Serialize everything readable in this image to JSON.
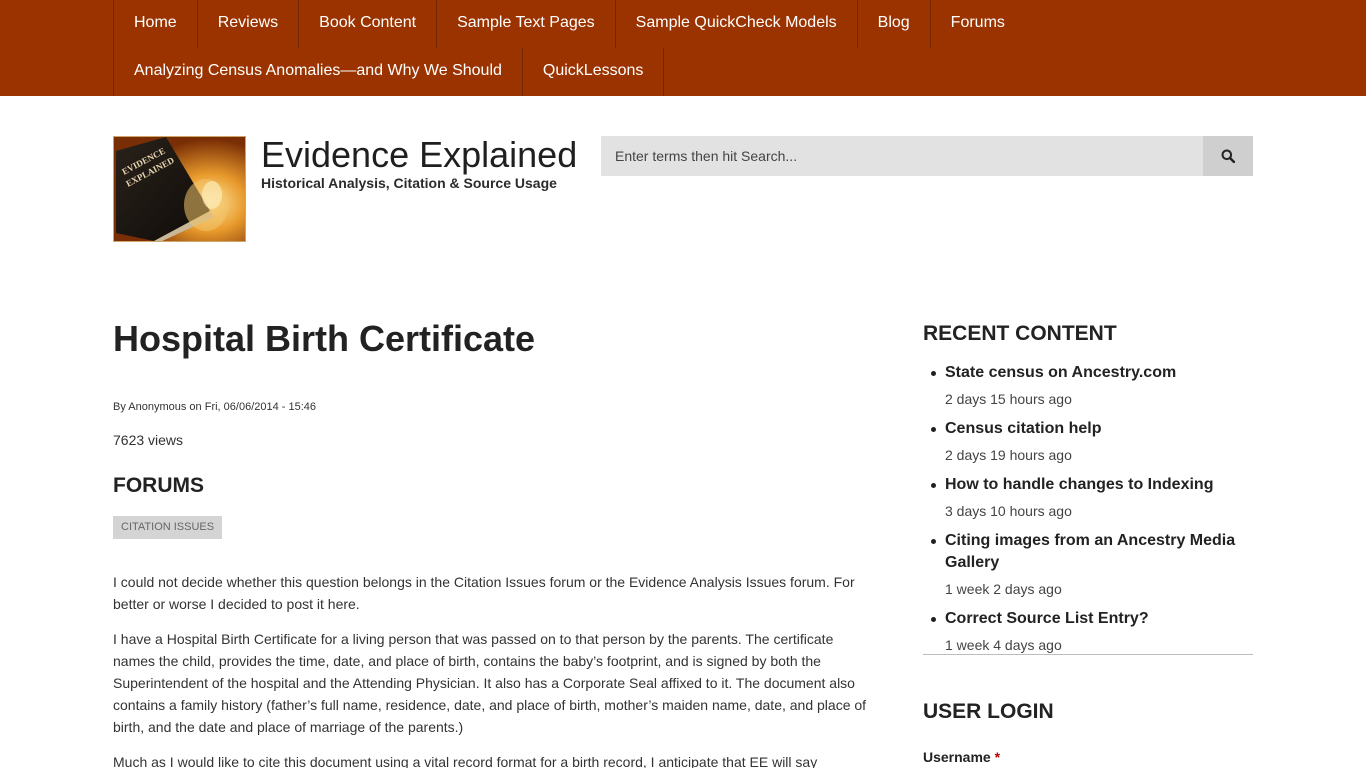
{
  "nav": {
    "row1": [
      "Home",
      "Reviews",
      "Book Content",
      "Sample Text Pages",
      "Sample QuickCheck Models",
      "Blog",
      "Forums"
    ],
    "row2": [
      "Analyzing Census Anomalies—and Why We Should",
      "QuickLessons"
    ]
  },
  "site": {
    "name": "Evidence Explained",
    "slogan": "Historical Analysis, Citation & Source Usage",
    "logo_text": "EVIDENCE EXPLAINED"
  },
  "search": {
    "placeholder": "Enter terms then hit Search..."
  },
  "article": {
    "title": "Hospital Birth Certificate",
    "submitted": "By Anonymous on Fri, 06/06/2014 - 15:46",
    "views": "7623 views",
    "forums_heading": "FORUMS",
    "tag": "CITATION ISSUES",
    "paragraphs": [
      "I could not decide whether this question belongs in the Citation Issues forum or the Evidence Analysis Issues forum. For better or worse I decided to post it here.",
      "I have a Hospital Birth Certificate for a living person that was passed on to that person by the parents. The certificate names the child, provides the time, date, and place of birth, contains the baby’s footprint, and is signed by both the Superintendent of the hospital and the Attending Physician. It also has a Corporate Seal affixed to it. The document also contains a family history (father’s full name, residence, date, and place of birth, mother’s maiden name, date, and place of birth, and the date and place of marriage of the parents.)",
      "Much as I would like to cite this document using a vital record format for a birth record, I anticipate that EE will say"
    ]
  },
  "sidebar": {
    "recent_heading": "RECENT CONTENT",
    "recent": [
      {
        "title": "State census on Ancestry.com",
        "time": "2 days 15 hours ago"
      },
      {
        "title": "Census citation help",
        "time": "2 days 19 hours ago"
      },
      {
        "title": "How to handle changes to Indexing",
        "time": "3 days 10 hours ago"
      },
      {
        "title": "Citing images from an Ancestry Media Gallery",
        "time": "1 week 2 days ago"
      },
      {
        "title": "Correct Source List Entry?",
        "time": "1 week 4 days ago"
      }
    ],
    "login_heading": "USER LOGIN",
    "username_label": "Username",
    "required_mark": "*"
  },
  "colors": {
    "nav_bg": "#9b3300",
    "search_bg": "#e2e2e2",
    "tag_bg": "#d4d4d4"
  }
}
